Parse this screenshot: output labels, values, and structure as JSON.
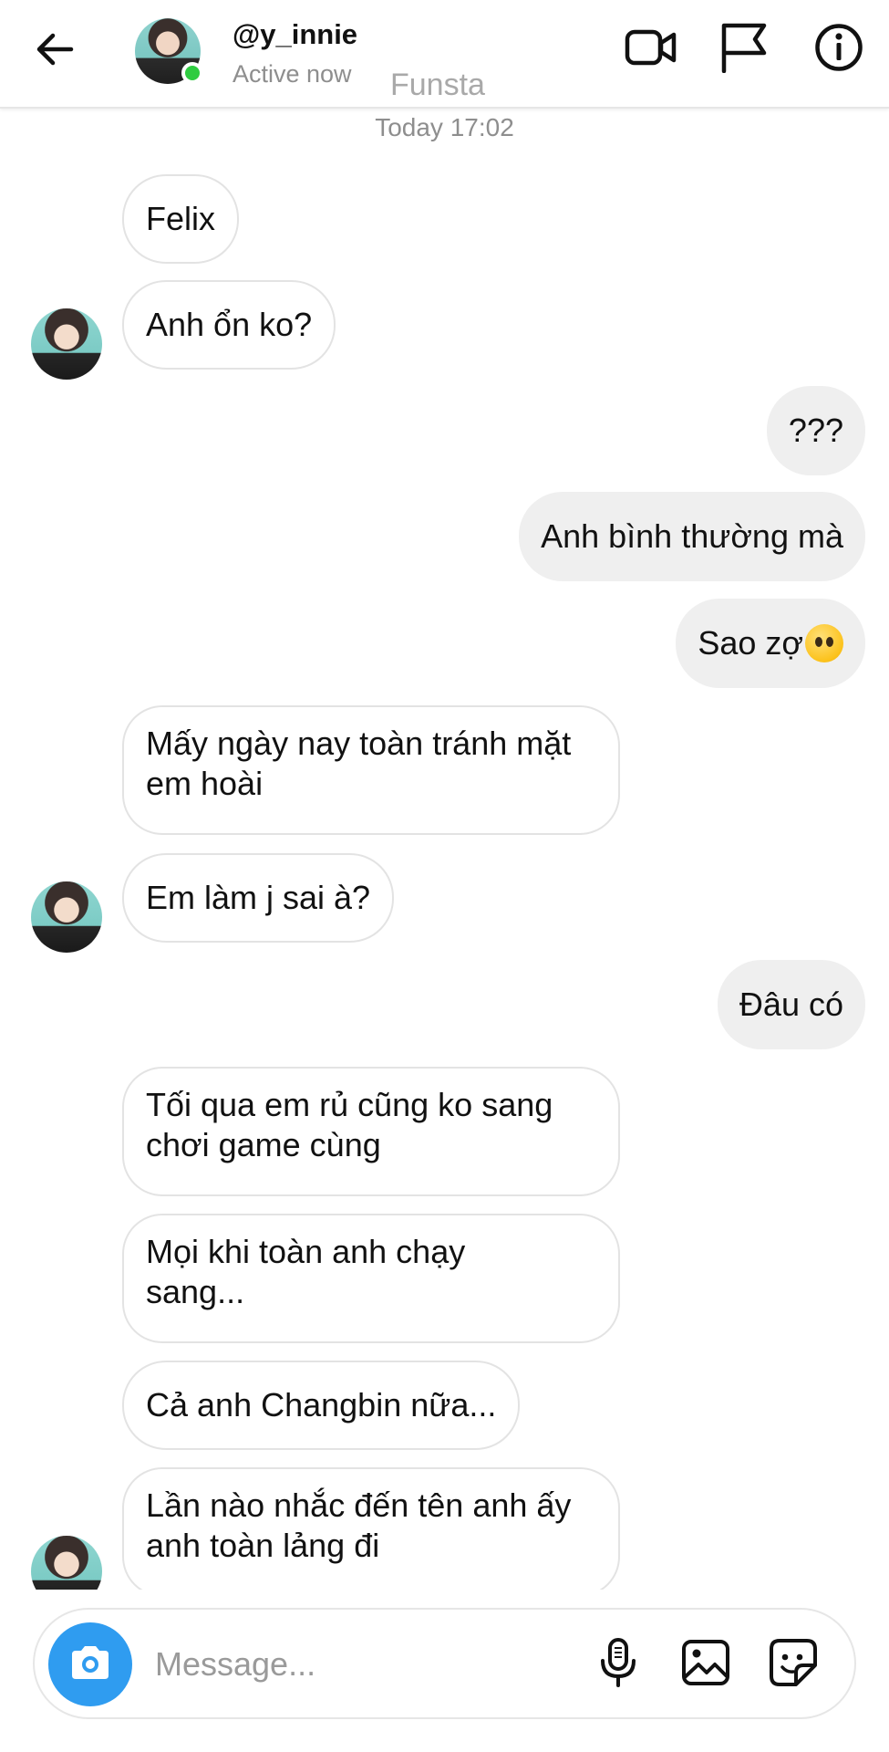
{
  "header": {
    "username": "@y_innie",
    "status": "Active now",
    "watermark": "Funsta",
    "icons": [
      "back-arrow-icon",
      "video-call-icon",
      "flag-icon",
      "info-icon"
    ]
  },
  "chat": {
    "timestamp": "Today 17:02",
    "messages": [
      {
        "from": "them",
        "text": "Felix"
      },
      {
        "from": "them",
        "text": "Anh ổn ko?"
      },
      {
        "from": "me",
        "text": "???"
      },
      {
        "from": "me",
        "text": "Anh bình thường mà"
      },
      {
        "from": "me",
        "text": "Sao zợ",
        "emoji": "neutral-face-emoji"
      },
      {
        "from": "them",
        "lines": [
          "Mấy ngày nay toàn tránh mặt",
          "em hoài"
        ]
      },
      {
        "from": "them",
        "text": "Em làm j sai à?"
      },
      {
        "from": "me",
        "text": "Đâu có"
      },
      {
        "from": "them",
        "lines": [
          "Tối qua em rủ cũng ko sang",
          "chơi game cùng"
        ]
      },
      {
        "from": "them",
        "lines": [
          "Mọi khi toàn anh chạy",
          "sang..."
        ]
      },
      {
        "from": "them",
        "text": "Cả anh Changbin nữa..."
      },
      {
        "from": "them",
        "lines": [
          "Lần nào nhắc đến tên anh ấy",
          "anh toàn lảng đi"
        ]
      }
    ]
  },
  "composer": {
    "placeholder": "Message...",
    "icons": [
      "camera-icon",
      "microphone-icon",
      "gallery-icon",
      "sticker-icon"
    ]
  },
  "colors": {
    "accent": "#2f9cf0",
    "online": "#2ecc40",
    "outgoing_bubble": "#efefef",
    "incoming_border": "#e3e3e3"
  }
}
